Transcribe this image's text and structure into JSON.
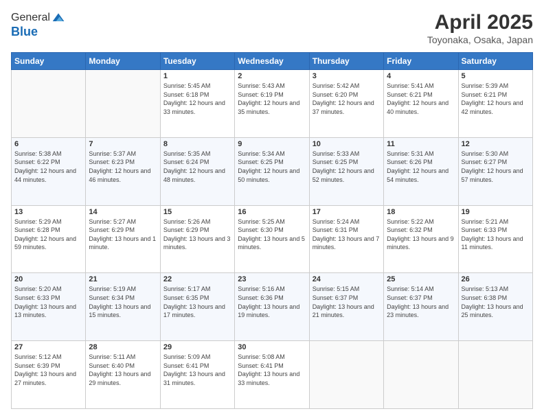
{
  "logo": {
    "general": "General",
    "blue": "Blue"
  },
  "header": {
    "title": "April 2025",
    "subtitle": "Toyonaka, Osaka, Japan"
  },
  "days": [
    "Sunday",
    "Monday",
    "Tuesday",
    "Wednesday",
    "Thursday",
    "Friday",
    "Saturday"
  ],
  "weeks": [
    [
      {
        "date": "",
        "sunrise": "",
        "sunset": "",
        "daylight": ""
      },
      {
        "date": "",
        "sunrise": "",
        "sunset": "",
        "daylight": ""
      },
      {
        "date": "1",
        "sunrise": "Sunrise: 5:45 AM",
        "sunset": "Sunset: 6:18 PM",
        "daylight": "Daylight: 12 hours and 33 minutes."
      },
      {
        "date": "2",
        "sunrise": "Sunrise: 5:43 AM",
        "sunset": "Sunset: 6:19 PM",
        "daylight": "Daylight: 12 hours and 35 minutes."
      },
      {
        "date": "3",
        "sunrise": "Sunrise: 5:42 AM",
        "sunset": "Sunset: 6:20 PM",
        "daylight": "Daylight: 12 hours and 37 minutes."
      },
      {
        "date": "4",
        "sunrise": "Sunrise: 5:41 AM",
        "sunset": "Sunset: 6:21 PM",
        "daylight": "Daylight: 12 hours and 40 minutes."
      },
      {
        "date": "5",
        "sunrise": "Sunrise: 5:39 AM",
        "sunset": "Sunset: 6:21 PM",
        "daylight": "Daylight: 12 hours and 42 minutes."
      }
    ],
    [
      {
        "date": "6",
        "sunrise": "Sunrise: 5:38 AM",
        "sunset": "Sunset: 6:22 PM",
        "daylight": "Daylight: 12 hours and 44 minutes."
      },
      {
        "date": "7",
        "sunrise": "Sunrise: 5:37 AM",
        "sunset": "Sunset: 6:23 PM",
        "daylight": "Daylight: 12 hours and 46 minutes."
      },
      {
        "date": "8",
        "sunrise": "Sunrise: 5:35 AM",
        "sunset": "Sunset: 6:24 PM",
        "daylight": "Daylight: 12 hours and 48 minutes."
      },
      {
        "date": "9",
        "sunrise": "Sunrise: 5:34 AM",
        "sunset": "Sunset: 6:25 PM",
        "daylight": "Daylight: 12 hours and 50 minutes."
      },
      {
        "date": "10",
        "sunrise": "Sunrise: 5:33 AM",
        "sunset": "Sunset: 6:25 PM",
        "daylight": "Daylight: 12 hours and 52 minutes."
      },
      {
        "date": "11",
        "sunrise": "Sunrise: 5:31 AM",
        "sunset": "Sunset: 6:26 PM",
        "daylight": "Daylight: 12 hours and 54 minutes."
      },
      {
        "date": "12",
        "sunrise": "Sunrise: 5:30 AM",
        "sunset": "Sunset: 6:27 PM",
        "daylight": "Daylight: 12 hours and 57 minutes."
      }
    ],
    [
      {
        "date": "13",
        "sunrise": "Sunrise: 5:29 AM",
        "sunset": "Sunset: 6:28 PM",
        "daylight": "Daylight: 12 hours and 59 minutes."
      },
      {
        "date": "14",
        "sunrise": "Sunrise: 5:27 AM",
        "sunset": "Sunset: 6:29 PM",
        "daylight": "Daylight: 13 hours and 1 minute."
      },
      {
        "date": "15",
        "sunrise": "Sunrise: 5:26 AM",
        "sunset": "Sunset: 6:29 PM",
        "daylight": "Daylight: 13 hours and 3 minutes."
      },
      {
        "date": "16",
        "sunrise": "Sunrise: 5:25 AM",
        "sunset": "Sunset: 6:30 PM",
        "daylight": "Daylight: 13 hours and 5 minutes."
      },
      {
        "date": "17",
        "sunrise": "Sunrise: 5:24 AM",
        "sunset": "Sunset: 6:31 PM",
        "daylight": "Daylight: 13 hours and 7 minutes."
      },
      {
        "date": "18",
        "sunrise": "Sunrise: 5:22 AM",
        "sunset": "Sunset: 6:32 PM",
        "daylight": "Daylight: 13 hours and 9 minutes."
      },
      {
        "date": "19",
        "sunrise": "Sunrise: 5:21 AM",
        "sunset": "Sunset: 6:33 PM",
        "daylight": "Daylight: 13 hours and 11 minutes."
      }
    ],
    [
      {
        "date": "20",
        "sunrise": "Sunrise: 5:20 AM",
        "sunset": "Sunset: 6:33 PM",
        "daylight": "Daylight: 13 hours and 13 minutes."
      },
      {
        "date": "21",
        "sunrise": "Sunrise: 5:19 AM",
        "sunset": "Sunset: 6:34 PM",
        "daylight": "Daylight: 13 hours and 15 minutes."
      },
      {
        "date": "22",
        "sunrise": "Sunrise: 5:17 AM",
        "sunset": "Sunset: 6:35 PM",
        "daylight": "Daylight: 13 hours and 17 minutes."
      },
      {
        "date": "23",
        "sunrise": "Sunrise: 5:16 AM",
        "sunset": "Sunset: 6:36 PM",
        "daylight": "Daylight: 13 hours and 19 minutes."
      },
      {
        "date": "24",
        "sunrise": "Sunrise: 5:15 AM",
        "sunset": "Sunset: 6:37 PM",
        "daylight": "Daylight: 13 hours and 21 minutes."
      },
      {
        "date": "25",
        "sunrise": "Sunrise: 5:14 AM",
        "sunset": "Sunset: 6:37 PM",
        "daylight": "Daylight: 13 hours and 23 minutes."
      },
      {
        "date": "26",
        "sunrise": "Sunrise: 5:13 AM",
        "sunset": "Sunset: 6:38 PM",
        "daylight": "Daylight: 13 hours and 25 minutes."
      }
    ],
    [
      {
        "date": "27",
        "sunrise": "Sunrise: 5:12 AM",
        "sunset": "Sunset: 6:39 PM",
        "daylight": "Daylight: 13 hours and 27 minutes."
      },
      {
        "date": "28",
        "sunrise": "Sunrise: 5:11 AM",
        "sunset": "Sunset: 6:40 PM",
        "daylight": "Daylight: 13 hours and 29 minutes."
      },
      {
        "date": "29",
        "sunrise": "Sunrise: 5:09 AM",
        "sunset": "Sunset: 6:41 PM",
        "daylight": "Daylight: 13 hours and 31 minutes."
      },
      {
        "date": "30",
        "sunrise": "Sunrise: 5:08 AM",
        "sunset": "Sunset: 6:41 PM",
        "daylight": "Daylight: 13 hours and 33 minutes."
      },
      {
        "date": "",
        "sunrise": "",
        "sunset": "",
        "daylight": ""
      },
      {
        "date": "",
        "sunrise": "",
        "sunset": "",
        "daylight": ""
      },
      {
        "date": "",
        "sunrise": "",
        "sunset": "",
        "daylight": ""
      }
    ]
  ]
}
